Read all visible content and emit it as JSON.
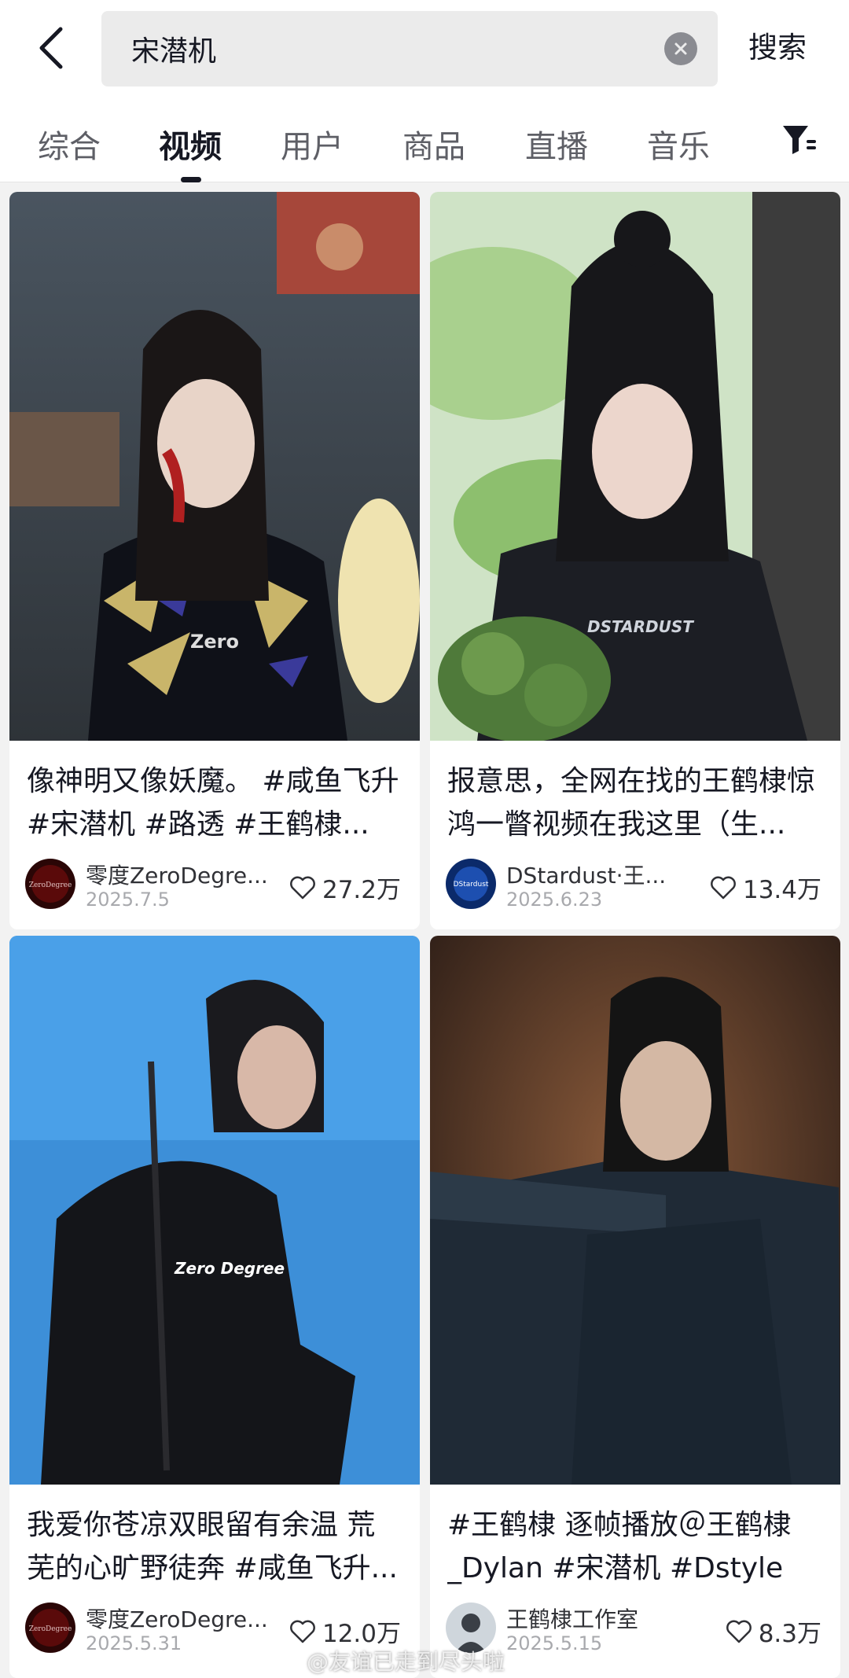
{
  "search": {
    "query": "宋潜机",
    "submit_label": "搜索"
  },
  "tabs": [
    {
      "label": "综合",
      "active": false
    },
    {
      "label": "视频",
      "active": true
    },
    {
      "label": "用户",
      "active": false
    },
    {
      "label": "商品",
      "active": false
    },
    {
      "label": "直播",
      "active": false
    },
    {
      "label": "音乐",
      "active": false
    }
  ],
  "videos": [
    {
      "title": "像神明又像妖魔。 #咸鱼飞升 #宋潜机 #路透 #王鹤棣...",
      "author": "零度ZeroDegre...",
      "date": "2025.7.5",
      "likes": "27.2万",
      "thumb_watermark": "Zero",
      "avatar_text": "ZeroDegree"
    },
    {
      "title": "报意思，全网在找的王鹤棣惊鸿一瞥视频在我这里（生...",
      "author": "DStardust·王...",
      "date": "2025.6.23",
      "likes": "13.4万",
      "thumb_watermark": "DSTARDUST",
      "avatar_text": "DStardust"
    },
    {
      "title": "我爱你苍凉双眼留有余温 荒芜的心旷野徒奔 #咸鱼飞升...",
      "author": "零度ZeroDegre...",
      "date": "2025.5.31",
      "likes": "12.0万",
      "thumb_watermark": "Zero Degree",
      "avatar_text": "ZeroDegree"
    },
    {
      "title": "#王鹤棣 逐帧播放＠王鹤棣_Dylan #宋潜机 #Dstyle",
      "author": "王鹤棣工作室",
      "date": "2025.5.15",
      "likes": "8.3万",
      "thumb_watermark": "",
      "avatar_text": ""
    }
  ],
  "watermark": "@友谊已走到尽头啦",
  "colors": {
    "background": "#f2f2f2",
    "card": "#ffffff",
    "text_primary": "#161823",
    "text_secondary": "#a8a9ad"
  }
}
